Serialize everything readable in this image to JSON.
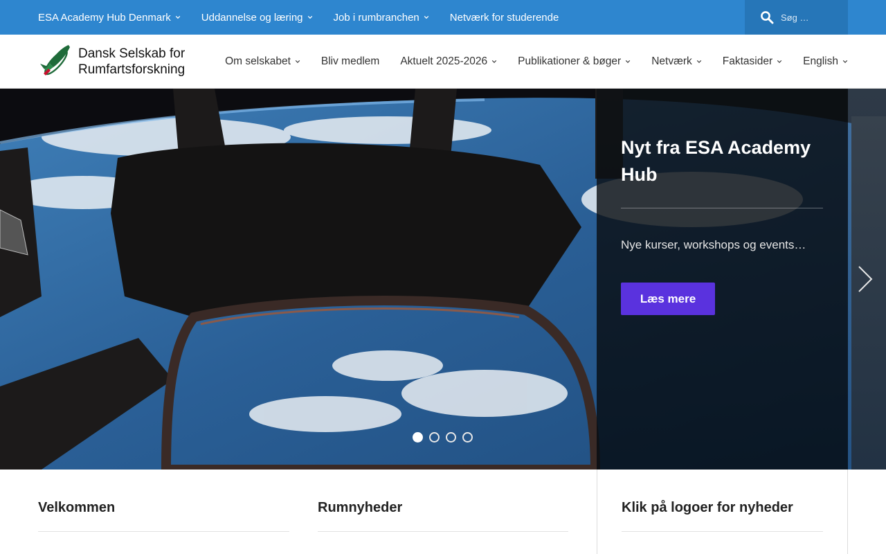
{
  "topnav": {
    "items": [
      {
        "label": "ESA Academy Hub Denmark",
        "has_dropdown": true
      },
      {
        "label": "Uddannelse og læring",
        "has_dropdown": true
      },
      {
        "label": "Job i rumbranchen",
        "has_dropdown": true
      },
      {
        "label": "Netværk for studerende",
        "has_dropdown": false
      }
    ],
    "search": {
      "placeholder": "Søg …",
      "icon": "search-icon"
    }
  },
  "header": {
    "logo": {
      "line1": "Dansk Selskab for",
      "line2": "Rumfartsforskning",
      "icon": "rocket-logo"
    },
    "nav": [
      {
        "label": "Om selskabet",
        "has_dropdown": true
      },
      {
        "label": "Bliv medlem",
        "has_dropdown": false
      },
      {
        "label": "Aktuelt 2025-2026",
        "has_dropdown": true
      },
      {
        "label": "Publikationer & bøger",
        "has_dropdown": true
      },
      {
        "label": "Netværk",
        "has_dropdown": true
      },
      {
        "label": "Faktasider",
        "has_dropdown": true
      },
      {
        "label": "English",
        "has_dropdown": true
      }
    ]
  },
  "hero": {
    "title": "Nyt fra ESA Academy Hub",
    "description": "Nye kurser, workshops og events…",
    "button_label": "Læs mere",
    "slides_count": 4,
    "active_slide": 1
  },
  "widgets": {
    "col1_title": "Velkommen",
    "col2_title": "Rumnyheder",
    "sidebar_title": "Klik på logoer for nyheder"
  },
  "colors": {
    "topbar": "#2e86cf",
    "search_bg": "#2676b8",
    "button": "#5a32de",
    "logo_green": "#1f6b3a"
  }
}
